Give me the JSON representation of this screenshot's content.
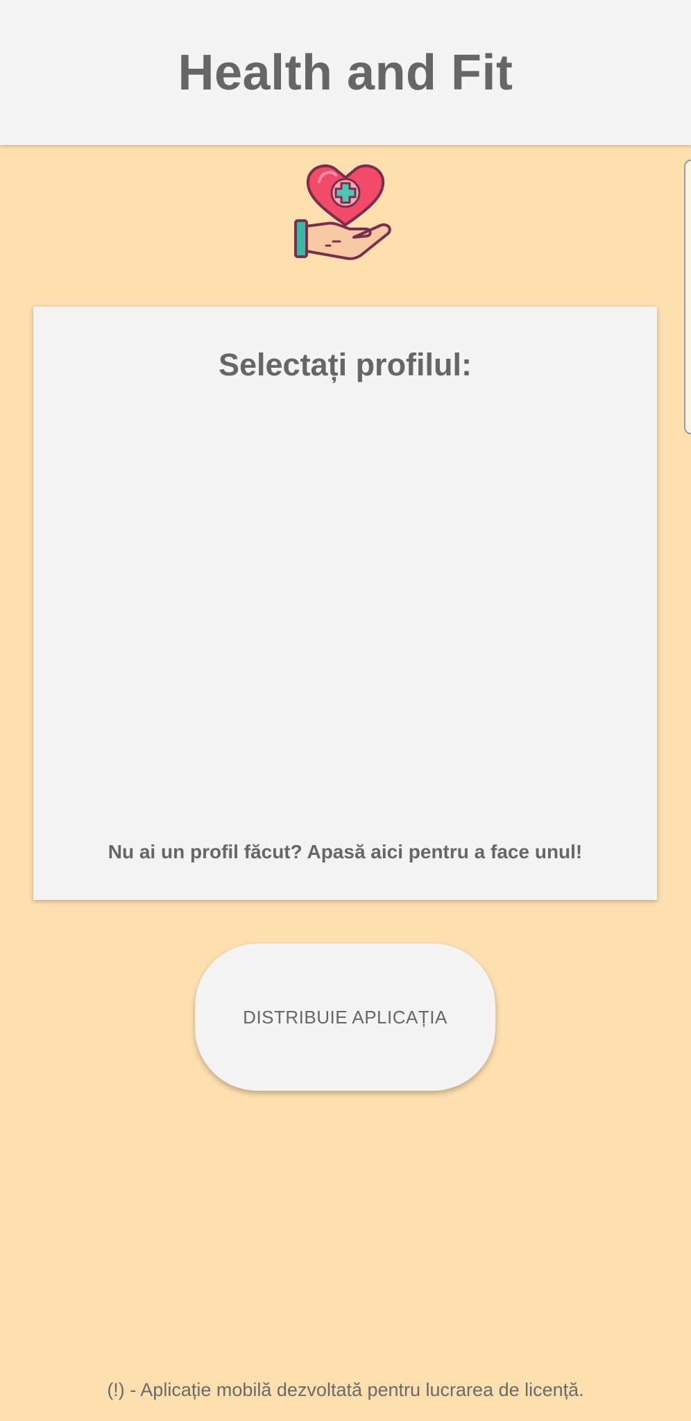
{
  "header": {
    "title": "Health and Fit"
  },
  "logo": {
    "icon": "heart-in-hand-icon",
    "colors": {
      "heart": "#F24B6A",
      "cross": "#4FC3B4",
      "hand": "#F9C9A6",
      "cuff": "#3DB8A8",
      "outline": "#7A2E4A"
    }
  },
  "profile_card": {
    "title": "Selectați profilul:",
    "profiles": [],
    "create_link": "Nu ai un profil făcut? Apasă aici pentru a face unul!"
  },
  "share_button": {
    "label": "DISTRIBUIE APLICAȚIA"
  },
  "footer": {
    "note": "(!) - Aplicație mobilă dezvoltată pentru lucrarea de licență."
  },
  "theme": {
    "background": "#FDDFB0",
    "surface": "#F4F4F4",
    "text": "#666666"
  }
}
